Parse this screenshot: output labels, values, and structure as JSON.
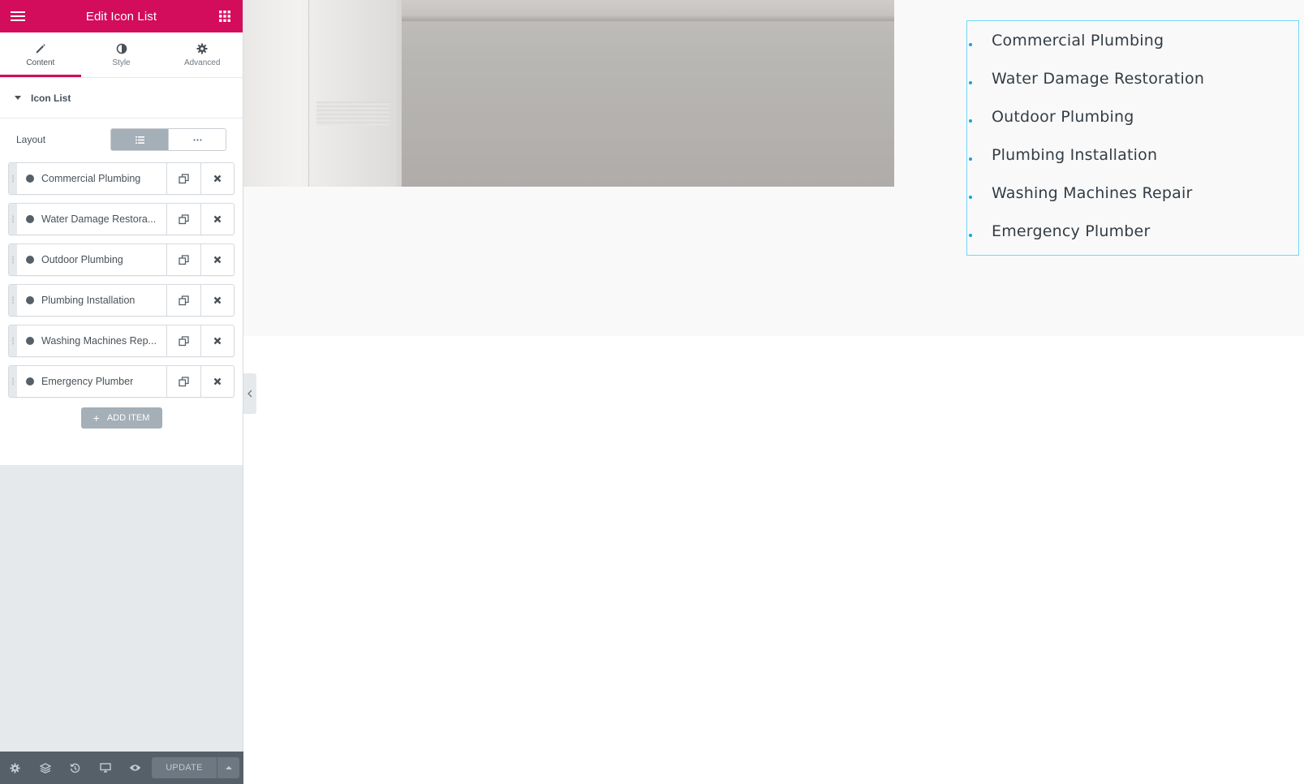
{
  "panel": {
    "title": "Edit Icon List",
    "tabs": [
      {
        "label": "Content",
        "icon": "pencil-icon",
        "active": true
      },
      {
        "label": "Style",
        "icon": "contrast-icon",
        "active": false
      },
      {
        "label": "Advanced",
        "icon": "gear-icon",
        "active": false
      }
    ],
    "section_title": "Icon List",
    "layout_label": "Layout",
    "layout_options": [
      "list-icon",
      "ellipsis-icon"
    ],
    "layout_selected": "list-icon",
    "items": [
      {
        "label": "Commercial Plumbing"
      },
      {
        "label": "Water Damage Restora..."
      },
      {
        "label": "Outdoor Plumbing"
      },
      {
        "label": "Plumbing Installation"
      },
      {
        "label": "Washing Machines Rep..."
      },
      {
        "label": "Emergency Plumber"
      }
    ],
    "add_item_label": "ADD ITEM",
    "footer": {
      "icons": [
        "gear-icon",
        "layers-icon",
        "history-icon",
        "responsive-icon",
        "eye-icon"
      ],
      "update_label": "UPDATE"
    },
    "accent_color": "#d30c5c"
  },
  "preview": {
    "list_items": [
      "Commercial Plumbing",
      "Water Damage Restoration",
      "Outdoor Plumbing",
      "Plumbing Installation",
      "Washing Machines Repair",
      "Emergency Plumber"
    ],
    "bullet_color": "#1aa3d6",
    "selection_outline_color": "#71d7f7"
  }
}
